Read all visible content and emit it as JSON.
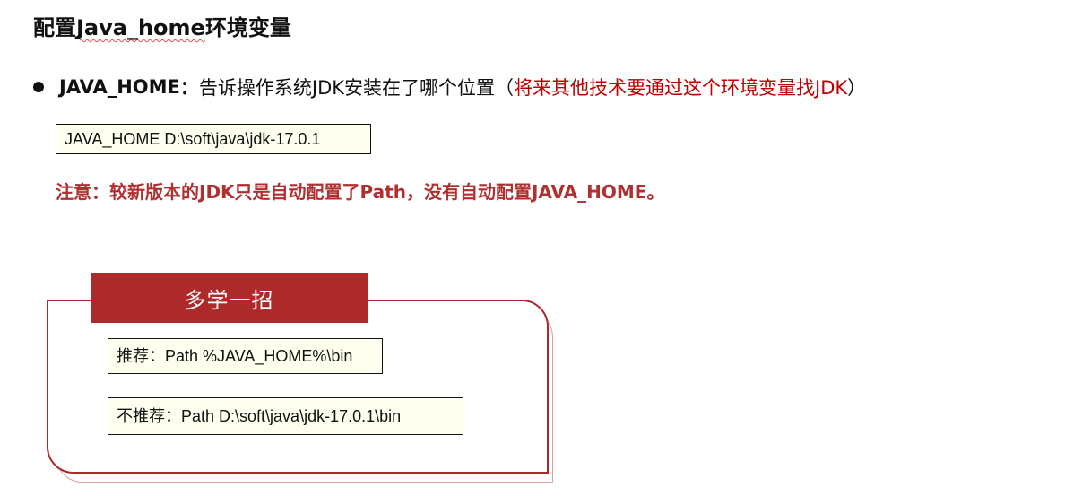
{
  "slide": {
    "title_prefix": "配置",
    "title_term": "Java_home",
    "title_suffix": "环境变量"
  },
  "bullet": {
    "term": "JAVA_HOME",
    "colon": "：",
    "description": "告诉操作系统JDK安装在了哪个位置（",
    "note_red": "将来其他技术要通过这个环境变量找JDK",
    "close_paren": "）"
  },
  "javahome_box": {
    "text": "JAVA_HOME  D:\\soft\\java\\jdk-17.0.1"
  },
  "note": {
    "text": "注意：较新版本的JDK只是自动配置了Path，没有自动配置JAVA_HOME。"
  },
  "tip": {
    "header": "多学一招",
    "recommended": "推荐：Path  %JAVA_HOME%\\bin",
    "not_recommended": "不推荐：Path D:\\soft\\java\\jdk-17.0.1\\bin"
  },
  "colors": {
    "accent_red": "#ad2a2a",
    "text_red": "#c00000",
    "box_fill": "#fffff0"
  }
}
